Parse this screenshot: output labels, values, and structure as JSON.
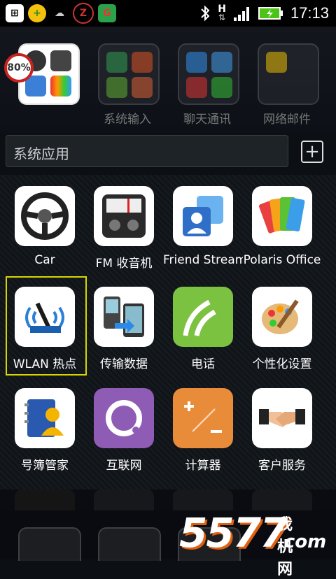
{
  "status_bar": {
    "time": "17:13",
    "network_type": "H",
    "icons": [
      "notification-icon",
      "add-icon",
      "weather-icon",
      "z-icon",
      "g-icon",
      "bluetooth-icon",
      "data-icon",
      "signal-icon",
      "battery-icon"
    ]
  },
  "folders": [
    {
      "label": "",
      "badge": "80%"
    },
    {
      "label": "系统输入"
    },
    {
      "label": "聊天通讯"
    },
    {
      "label": "网络邮件"
    }
  ],
  "current_folder": {
    "name": "系统应用"
  },
  "apps": [
    {
      "label": "Car",
      "icon": "steering-wheel-icon"
    },
    {
      "label": "FM 收音机",
      "icon": "radio-icon"
    },
    {
      "label": "Friend Stream",
      "icon": "contacts-icon"
    },
    {
      "label": "Polaris Office",
      "icon": "office-icon"
    },
    {
      "label": "WLAN 热点",
      "icon": "wifi-hotspot-icon"
    },
    {
      "label": "传输数据",
      "icon": "transfer-icon"
    },
    {
      "label": "电话",
      "icon": "phone-icon"
    },
    {
      "label": "个性化设置",
      "icon": "palette-icon"
    },
    {
      "label": "号簿管家",
      "icon": "address-book-icon"
    },
    {
      "label": "互联网",
      "icon": "browser-icon"
    },
    {
      "label": "计算器",
      "icon": "calculator-icon"
    },
    {
      "label": "客户服务",
      "icon": "handshake-icon"
    }
  ],
  "watermark": {
    "number": "5577",
    "site_cn": "我机网",
    "site": ".com"
  },
  "colors": {
    "selection": "#d6d600",
    "battery": "#4cc417",
    "badge_ring": "#c8221f",
    "web_purple": "#8e5bb5",
    "calc_orange": "#e98c3a",
    "phone_green": "#7cc241"
  }
}
